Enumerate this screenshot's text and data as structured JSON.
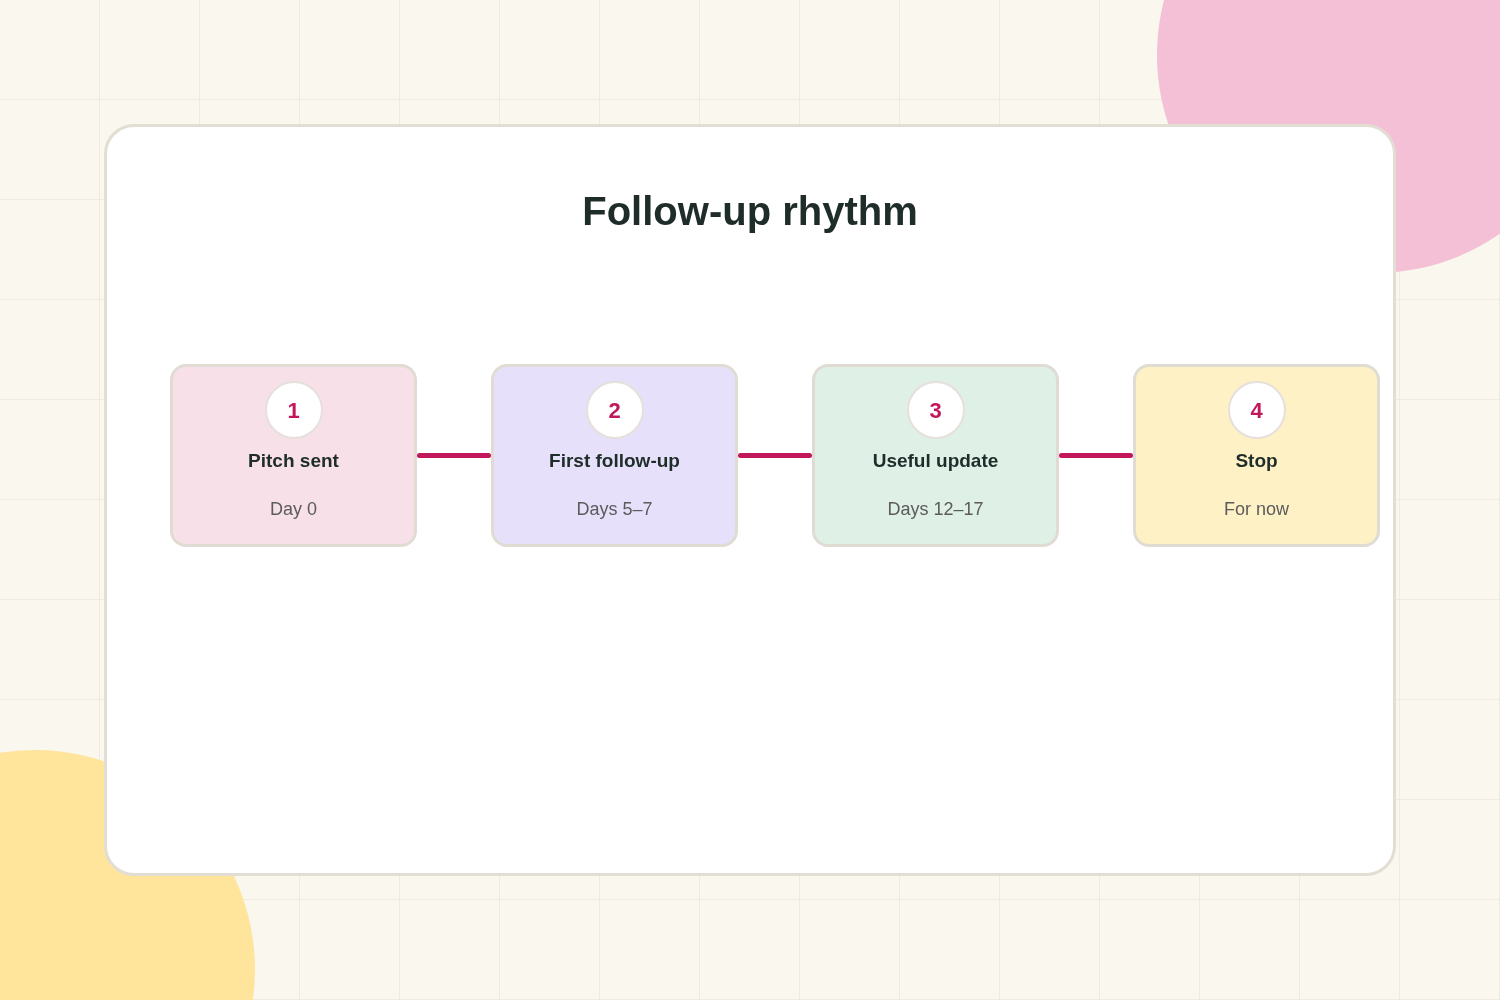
{
  "title": "Follow-up rhythm",
  "steps": [
    {
      "number": "1",
      "title": "Pitch sent",
      "subtitle": "Day 0",
      "color": "#f7e0e8"
    },
    {
      "number": "2",
      "title": "First follow-up",
      "subtitle": "Days 5–7",
      "color": "#e6e0fb"
    },
    {
      "number": "3",
      "title": "Useful update",
      "subtitle": "Days 12–17",
      "color": "#dff0e7"
    },
    {
      "number": "4",
      "title": "Stop",
      "subtitle": "For now",
      "color": "#fef1c6"
    }
  ]
}
